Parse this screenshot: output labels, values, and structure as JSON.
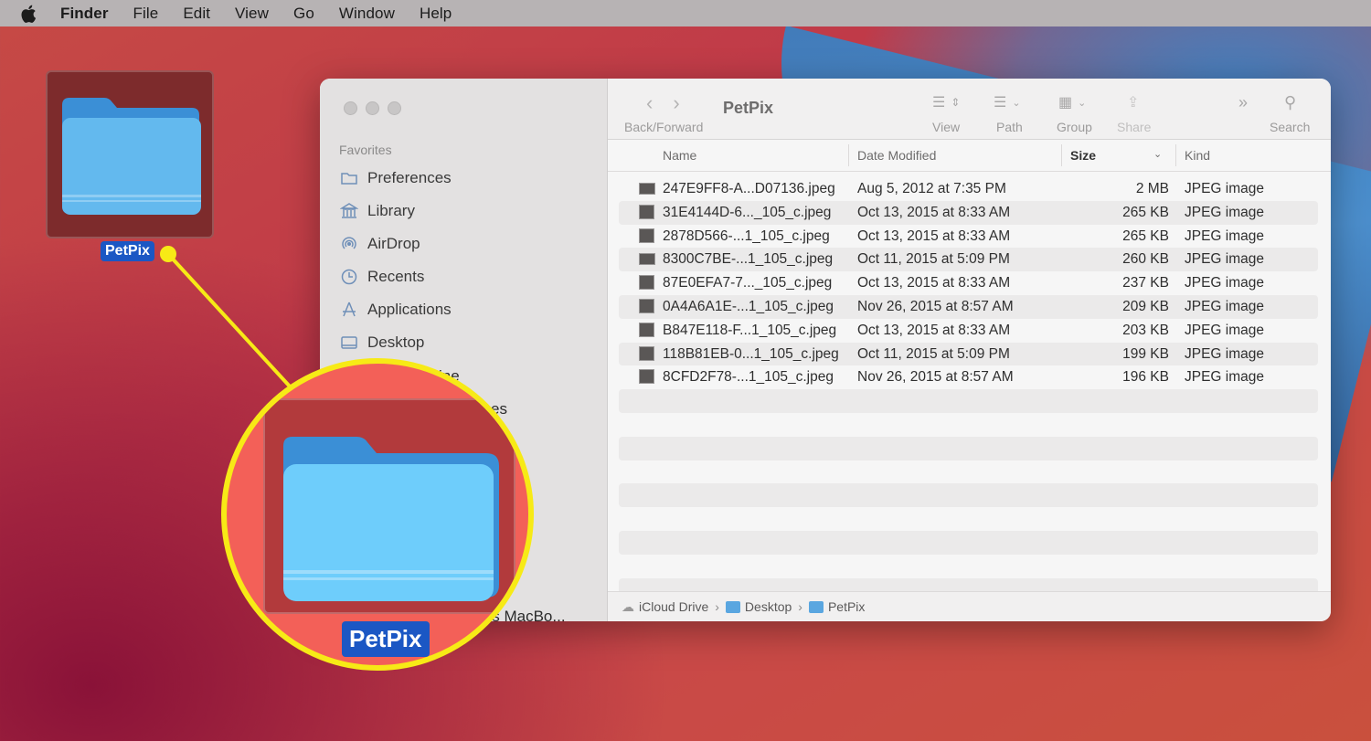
{
  "menubar": {
    "items": [
      "Finder",
      "File",
      "Edit",
      "View",
      "Go",
      "Window",
      "Help"
    ]
  },
  "desktop": {
    "folder_label": "PetPix"
  },
  "window": {
    "title": "PetPix",
    "toolbar": {
      "back_forward_label": "Back/Forward",
      "view_label": "View",
      "path_label": "Path",
      "group_label": "Group",
      "share_label": "Share",
      "search_label": "Search"
    },
    "sidebar": {
      "section": "Favorites",
      "items": [
        {
          "label": "Preferences",
          "icon": "folder-icon"
        },
        {
          "label": "Library",
          "icon": "library-icon"
        },
        {
          "label": "AirDrop",
          "icon": "airdrop-icon"
        },
        {
          "label": "Recents",
          "icon": "clock-icon"
        },
        {
          "label": "Applications",
          "icon": "applications-icon"
        },
        {
          "label": "Desktop",
          "icon": "desktop-icon"
        }
      ],
      "partial_items": [
        "ine",
        "es",
        "'s MacBo..."
      ]
    },
    "columns": {
      "name": "Name",
      "date": "Date Modified",
      "size": "Size",
      "kind": "Kind"
    },
    "files": [
      {
        "name": "247E9FF8-A...D07136.jpeg",
        "date": "Aug 5, 2012 at 7:35 PM",
        "size": "2 MB",
        "kind": "JPEG image"
      },
      {
        "name": "31E4144D-6..._105_c.jpeg",
        "date": "Oct 13, 2015 at 8:33 AM",
        "size": "265 KB",
        "kind": "JPEG image"
      },
      {
        "name": "2878D566-...1_105_c.jpeg",
        "date": "Oct 13, 2015 at 8:33 AM",
        "size": "265 KB",
        "kind": "JPEG image"
      },
      {
        "name": "8300C7BE-...1_105_c.jpeg",
        "date": "Oct 11, 2015 at 5:09 PM",
        "size": "260 KB",
        "kind": "JPEG image"
      },
      {
        "name": "87E0EFA7-7..._105_c.jpeg",
        "date": "Oct 13, 2015 at 8:33 AM",
        "size": "237 KB",
        "kind": "JPEG image"
      },
      {
        "name": "0A4A6A1E-...1_105_c.jpeg",
        "date": "Nov 26, 2015 at 8:57 AM",
        "size": "209 KB",
        "kind": "JPEG image"
      },
      {
        "name": "B847E118-F...1_105_c.jpeg",
        "date": "Oct 13, 2015 at 8:33 AM",
        "size": "203 KB",
        "kind": "JPEG image"
      },
      {
        "name": "118B81EB-0...1_105_c.jpeg",
        "date": "Oct 11, 2015 at 5:09 PM",
        "size": "199 KB",
        "kind": "JPEG image"
      },
      {
        "name": "8CFD2F78-...1_105_c.jpeg",
        "date": "Nov 26, 2015 at 8:57 AM",
        "size": "196 KB",
        "kind": "JPEG image"
      }
    ],
    "pathbar": [
      "iCloud Drive",
      "Desktop",
      "PetPix"
    ]
  },
  "magnifier": {
    "label": "PetPix"
  },
  "colors": {
    "accent_selection": "#1b57c4",
    "highlight_yellow": "#f7ea16",
    "folder_blue": "#5ab8f0"
  }
}
